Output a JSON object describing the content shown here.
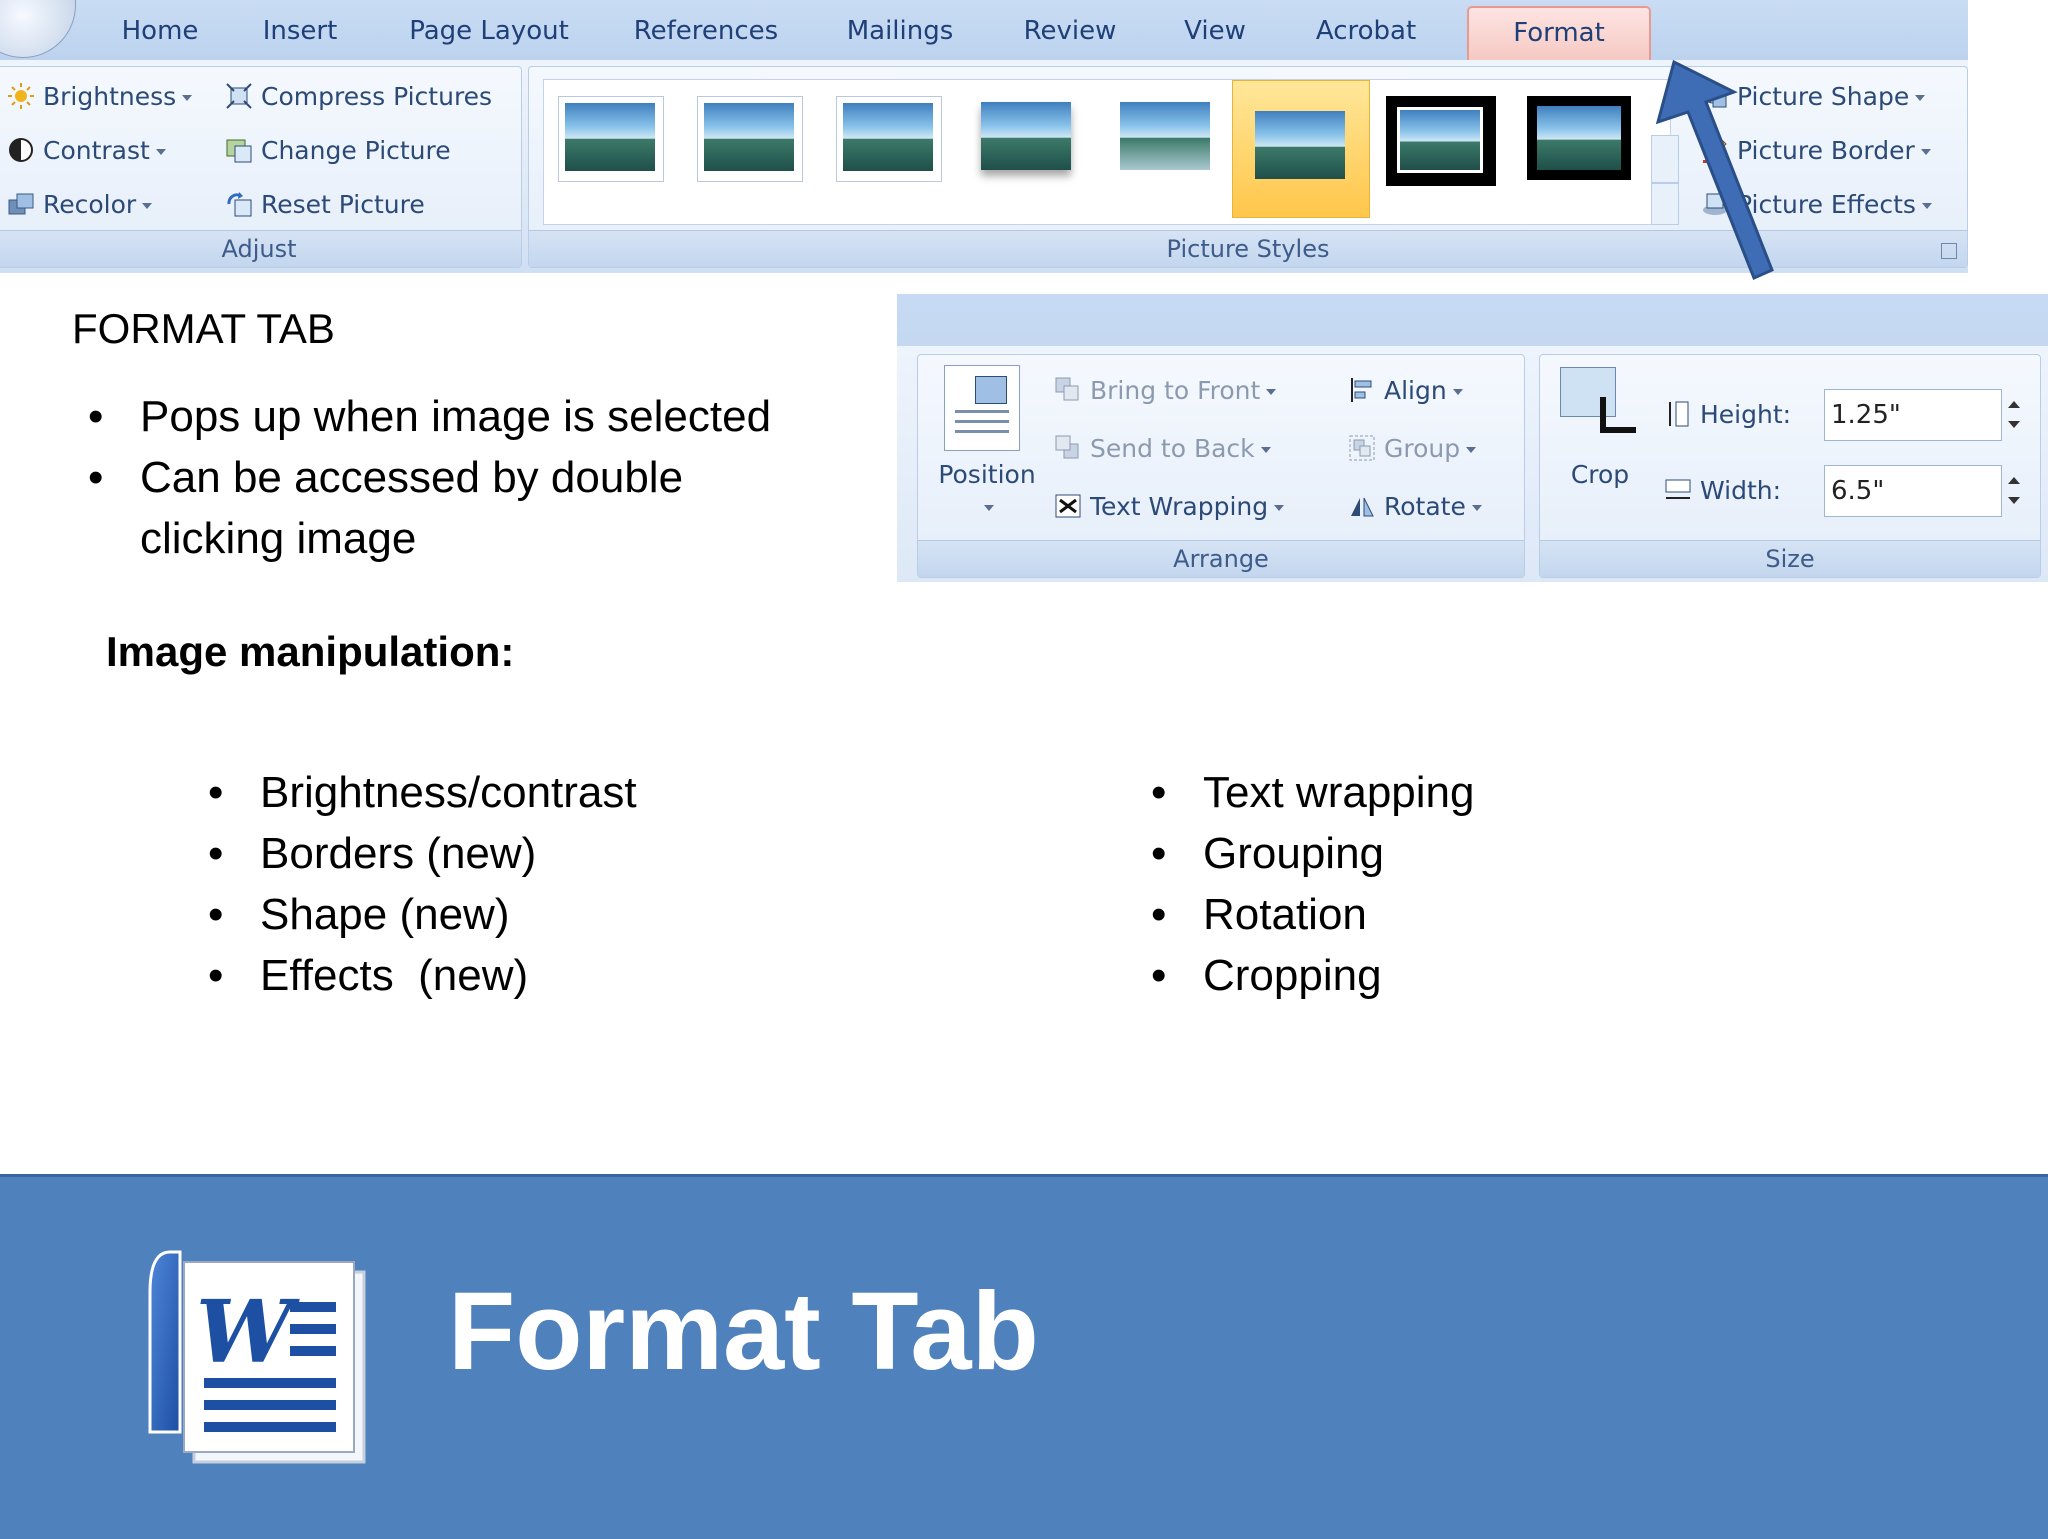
{
  "ribbon": {
    "tabs": [
      "Home",
      "Insert",
      "Page Layout",
      "References",
      "Mailings",
      "Review",
      "View",
      "Acrobat",
      "Format"
    ],
    "active_tab": "Format",
    "adjust": {
      "items": [
        "Brightness",
        "Contrast",
        "Recolor",
        "Compress Pictures",
        "Change Picture",
        "Reset Picture"
      ],
      "label": "Adjust"
    },
    "picture_styles": {
      "label": "Picture Styles",
      "items": [
        "Picture Shape",
        "Picture Border",
        "Picture Effects"
      ]
    }
  },
  "ribbon2": {
    "position_label": "Position",
    "arrange": {
      "label": "Arrange",
      "items": [
        "Bring to Front",
        "Send to Back",
        "Text Wrapping",
        "Align",
        "Group",
        "Rotate"
      ]
    },
    "size": {
      "label": "Size",
      "crop_label": "Crop",
      "height_label": "Height:",
      "height_value": "1.25\"",
      "width_label": "Width:",
      "width_value": "6.5\""
    }
  },
  "slide": {
    "heading": "FORMAT TAB",
    "intro_bullets": [
      "Pops up when image is selected",
      "Can be accessed by double clicking image"
    ],
    "subheading": "Image manipulation:",
    "left_bullets": [
      "Brightness/contrast",
      "Borders (new)",
      "Shape (new)",
      "Effects  (new)"
    ],
    "right_bullets": [
      "Text wrapping",
      "Grouping",
      "Rotation",
      "Cropping"
    ],
    "title": "Format Tab"
  },
  "colors": {
    "band": "#4f81bd",
    "ribbon": "#dbe7f6",
    "active_tab": "#f6c9c3",
    "arrow": "#3f6db5"
  }
}
